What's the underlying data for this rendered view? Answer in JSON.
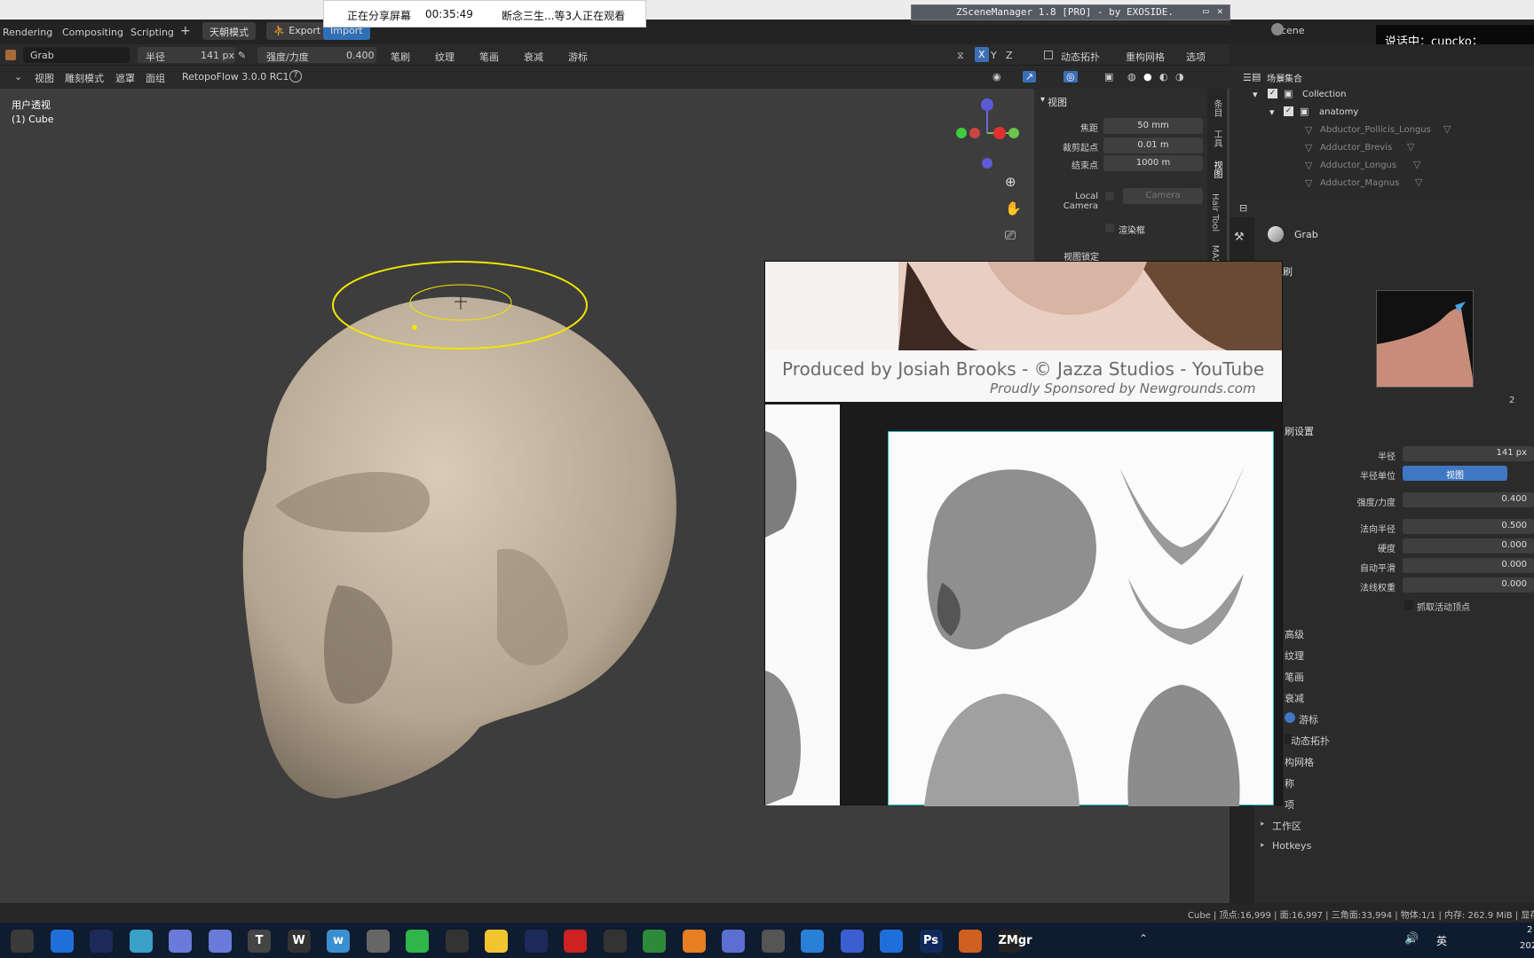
{
  "share": {
    "status": "正在分享屏幕",
    "timer": "00:35:49",
    "viewers": "断念三生...等3人正在观看"
  },
  "zscene": {
    "title": "ZSceneManager 1.8 [PRO]  -  by EXOSIDE."
  },
  "speaking": "说话中：cupcko；",
  "workspace": {
    "tabs": [
      "Rendering",
      "Compositing",
      "Scripting",
      "+"
    ],
    "mode_btn": "天朝模式",
    "export": "Export",
    "import": "Import",
    "scene": "Scene"
  },
  "toolhdr": {
    "tool": "Grab",
    "radius_label": "半径",
    "radius_value": "141 px",
    "strength_label": "强度/力度",
    "strength_value": "0.400",
    "menus": [
      "笔刷",
      "纹理",
      "笔画",
      "衰减",
      "游标"
    ],
    "axes": [
      "X",
      "Y",
      "Z"
    ],
    "dyntopo": "动态拓扑",
    "remesh": "重构网格",
    "options": "选项"
  },
  "viewhdr": {
    "items": [
      "视图",
      "雕刻模式",
      "遮罩",
      "面组"
    ],
    "retopo": "RetopoFlow 3.0.0 RC1"
  },
  "viewport": {
    "label1": "用户透视",
    "label2": "(1) Cube"
  },
  "npanel": {
    "section": "视图",
    "focal_label": "焦距",
    "focal_value": "50 mm",
    "clip_start_label": "裁剪起点",
    "clip_start_value": "0.01 m",
    "clip_end_label": "结束点",
    "clip_end_value": "1000 m",
    "local_camera": "Local Camera",
    "camera": "Camera",
    "render_border": "渲染框",
    "view_lock": "视图锁定",
    "tabs": [
      "条目",
      "工具",
      "视图",
      "Hair Tool",
      "MAX"
    ]
  },
  "outliner": {
    "root": "场景集合",
    "collection": "Collection",
    "anatomy": "anatomy",
    "items": [
      "Abductor_Pollicis_Longus",
      "Adductor_Brevis",
      "Adductor_Longus",
      "Adductor_Magnus"
    ]
  },
  "props": {
    "brush_name": "Grab",
    "brush_label": "刷",
    "brush_count": "2",
    "settings": "刷设置",
    "radius_label": "半径",
    "radius_value": "141 px",
    "radius_unit_label": "半径单位",
    "radius_unit_value": "视图",
    "strength_label": "强度/力度",
    "strength_value": "0.400",
    "normal_radius_label": "法向半径",
    "normal_radius_value": "0.500",
    "hardness_label": "硬度",
    "hardness_value": "0.000",
    "autosmooth_label": "自动平滑",
    "autosmooth_value": "0.000",
    "normal_weight_label": "法线权重",
    "normal_weight_value": "0.000",
    "grab_active": "抓取活动顶点",
    "sections": [
      "高级",
      "纹理",
      "笔画",
      "衰减",
      "游标",
      "动态拓扑",
      "构网格",
      "称",
      "项",
      "工作区",
      "Hotkeys"
    ]
  },
  "reference": {
    "produced": "Produced by Josiah Brooks - © Jazza Studios - YouTube",
    "sponsor": "Proudly Sponsored by Newgrounds.com"
  },
  "status": "Cube | 顶点:16,999 | 面:16,997 | 三角面:33,994 | 物体:1/1 | 内存: 262.9 MiB | 显存: 2.",
  "taskbar": {
    "icons": [
      "obs",
      "feishu",
      "blender-ribbon",
      "globe",
      "cinema4d",
      "cinema4d-2",
      "tx",
      "w",
      "wd",
      "owl",
      "wechat",
      "qq-ring",
      "note-yellow",
      "blender-2",
      "netease",
      "search-orange",
      "maps",
      "blender",
      "cloud-app",
      "zbrush",
      "photos",
      "tasks",
      "shield",
      "ps",
      "fm",
      "zmgr"
    ],
    "labels": {
      "w": "W",
      "wd": "w",
      "ps": "Ps",
      "zmgr": "ZMgr",
      "tx": "T"
    },
    "ime": "英",
    "clock_partial": "2",
    "date_partial": "202"
  }
}
